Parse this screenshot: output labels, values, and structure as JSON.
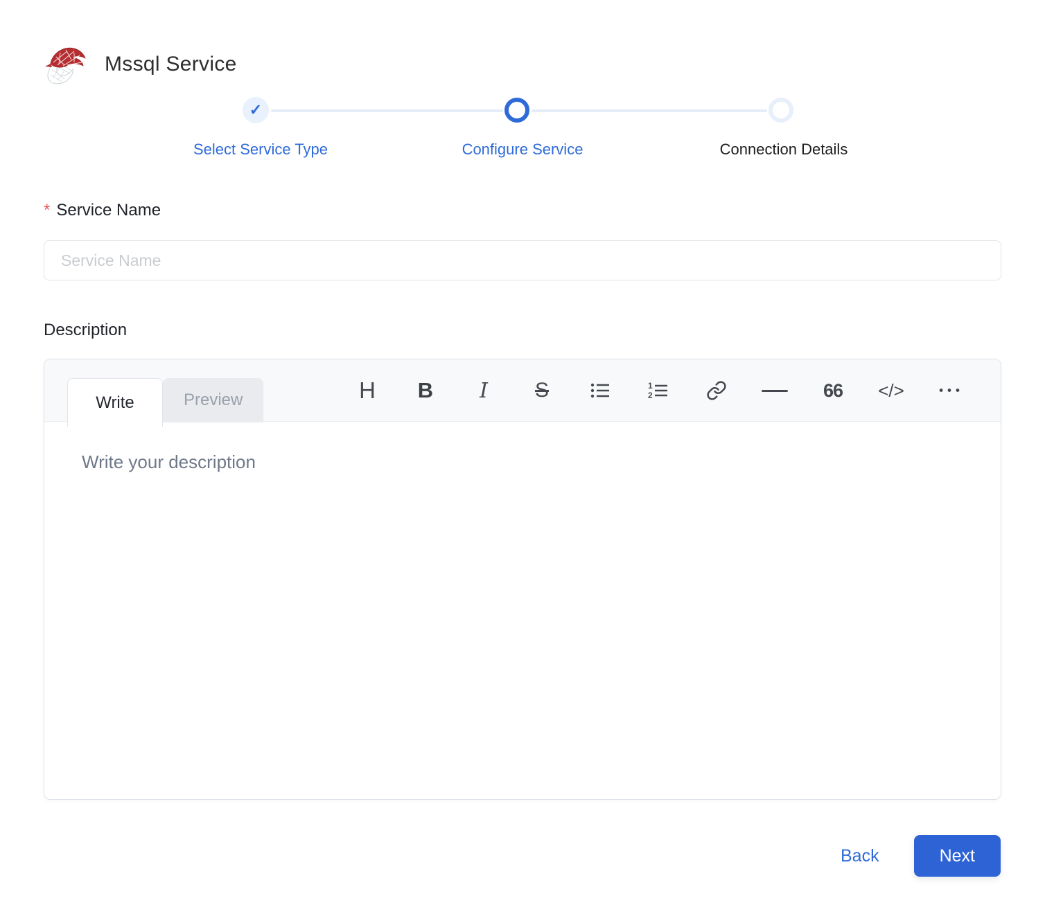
{
  "header": {
    "title": "Mssql Service",
    "logo_icon": "mssql-server-logo"
  },
  "stepper": {
    "steps": [
      {
        "label": "Select Service Type",
        "state": "completed",
        "icon": "check-icon",
        "check_glyph": "✓"
      },
      {
        "label": "Configure Service",
        "state": "active"
      },
      {
        "label": "Connection Details",
        "state": "pending"
      }
    ]
  },
  "form": {
    "service_name": {
      "label": "Service Name",
      "required_marker": "*",
      "placeholder": "Service Name",
      "value": ""
    },
    "description": {
      "label": "Description"
    }
  },
  "editor": {
    "tabs": [
      {
        "label": "Write",
        "active": true
      },
      {
        "label": "Preview",
        "active": false
      }
    ],
    "toolbar": [
      {
        "name": "heading-icon",
        "glyph": "H"
      },
      {
        "name": "bold-icon",
        "glyph": "B"
      },
      {
        "name": "italic-icon",
        "glyph": "I"
      },
      {
        "name": "strikethrough-icon",
        "glyph": "S"
      },
      {
        "name": "unordered-list-icon"
      },
      {
        "name": "ordered-list-icon"
      },
      {
        "name": "link-icon"
      },
      {
        "name": "horizontal-rule-icon"
      },
      {
        "name": "quote-icon",
        "glyph": "66"
      },
      {
        "name": "code-icon",
        "glyph": "</>"
      },
      {
        "name": "more-icon",
        "glyph": "•••"
      }
    ],
    "placeholder": "Write your description",
    "value": ""
  },
  "actions": {
    "back_label": "Back",
    "next_label": "Next"
  },
  "colors": {
    "primary_blue": "#2f6bd8",
    "button_blue": "#2e63d6",
    "step_pale_blue": "#e8f1fc",
    "required_red": "#ee5a5a",
    "toolbar_bg": "#f8f9fa",
    "inactive_tab_bg": "#e9ebee",
    "logo_red": "#b52e31",
    "logo_gray": "#c9d1d6"
  }
}
